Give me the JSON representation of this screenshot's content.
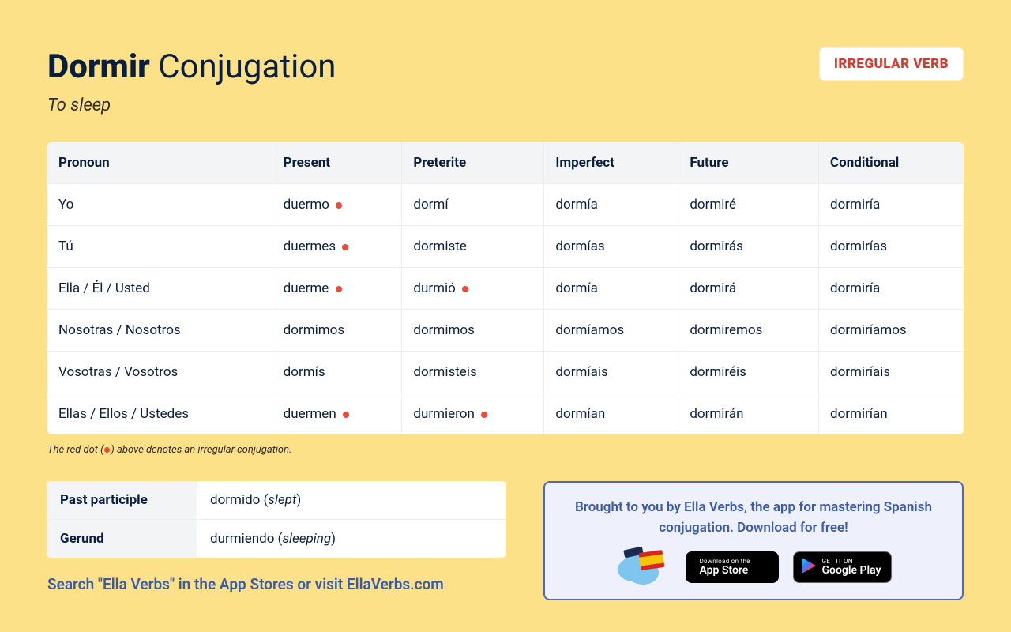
{
  "header": {
    "verb": "Dormir",
    "title_suffix": "Conjugation",
    "translation": "To sleep",
    "badge": "IRREGULAR VERB"
  },
  "table": {
    "headers": [
      "Pronoun",
      "Present",
      "Preterite",
      "Imperfect",
      "Future",
      "Conditional"
    ],
    "rows": [
      {
        "pronoun": "Yo",
        "cells": [
          {
            "t": "duermo",
            "irr": true
          },
          {
            "t": "dormí",
            "irr": false
          },
          {
            "t": "dormía",
            "irr": false
          },
          {
            "t": "dormiré",
            "irr": false
          },
          {
            "t": "dormiría",
            "irr": false
          }
        ]
      },
      {
        "pronoun": "Tú",
        "cells": [
          {
            "t": "duermes",
            "irr": true
          },
          {
            "t": "dormiste",
            "irr": false
          },
          {
            "t": "dormías",
            "irr": false
          },
          {
            "t": "dormirás",
            "irr": false
          },
          {
            "t": "dormirías",
            "irr": false
          }
        ]
      },
      {
        "pronoun": "Ella / Él / Usted",
        "cells": [
          {
            "t": "duerme",
            "irr": true
          },
          {
            "t": "durmió",
            "irr": true
          },
          {
            "t": "dormía",
            "irr": false
          },
          {
            "t": "dormirá",
            "irr": false
          },
          {
            "t": "dormiría",
            "irr": false
          }
        ]
      },
      {
        "pronoun": "Nosotras / Nosotros",
        "cells": [
          {
            "t": "dormimos",
            "irr": false
          },
          {
            "t": "dormimos",
            "irr": false
          },
          {
            "t": "dormíamos",
            "irr": false
          },
          {
            "t": "dormiremos",
            "irr": false
          },
          {
            "t": "dormiríamos",
            "irr": false
          }
        ]
      },
      {
        "pronoun": "Vosotras / Vosotros",
        "cells": [
          {
            "t": "dormís",
            "irr": false
          },
          {
            "t": "dormisteis",
            "irr": false
          },
          {
            "t": "dormíais",
            "irr": false
          },
          {
            "t": "dormiréis",
            "irr": false
          },
          {
            "t": "dormiríais",
            "irr": false
          }
        ]
      },
      {
        "pronoun": "Ellas / Ellos / Ustedes",
        "cells": [
          {
            "t": "duermen",
            "irr": true
          },
          {
            "t": "durmieron",
            "irr": true
          },
          {
            "t": "dormían",
            "irr": false
          },
          {
            "t": "dormirán",
            "irr": false
          },
          {
            "t": "dormirían",
            "irr": false
          }
        ]
      }
    ]
  },
  "footnote": {
    "pre": "The red dot (",
    "post": ") above denotes an irregular conjugation."
  },
  "forms": {
    "past_participle_label": "Past participle",
    "past_participle_value": "dormido",
    "past_participle_gloss": "slept",
    "gerund_label": "Gerund",
    "gerund_value": "durmiendo",
    "gerund_gloss": "sleeping"
  },
  "search_line": {
    "pre": "Search \"Ella Verbs\" in the App Stores or ",
    "link": "visit EllaVerbs.com"
  },
  "promo": {
    "line": "Brought to you by Ella Verbs, the app for mastering Spanish conjugation. Download for free!",
    "appstore_top": "Download on the",
    "appstore_bottom": "App Store",
    "play_top": "GET IT ON",
    "play_bottom": "Google Play"
  }
}
